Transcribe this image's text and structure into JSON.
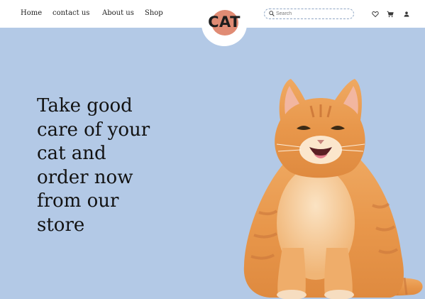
{
  "nav": {
    "items": [
      {
        "label": "Home"
      },
      {
        "label": "contact us"
      },
      {
        "label": "About us"
      },
      {
        "label": "Shop"
      }
    ]
  },
  "logo": {
    "text": "CAT"
  },
  "search": {
    "placeholder": "Search"
  },
  "icons": [
    "search-icon",
    "heart-icon",
    "cart-icon",
    "user-icon"
  ],
  "hero": {
    "lines": [
      "Take good",
      "care of your",
      "cat and",
      "order now",
      "from our",
      "store"
    ]
  },
  "colors": {
    "hero_bg": "#b3c9e6",
    "logo_blob": "#e08b74",
    "text": "#121212",
    "search_border": "#8fa6c4"
  }
}
